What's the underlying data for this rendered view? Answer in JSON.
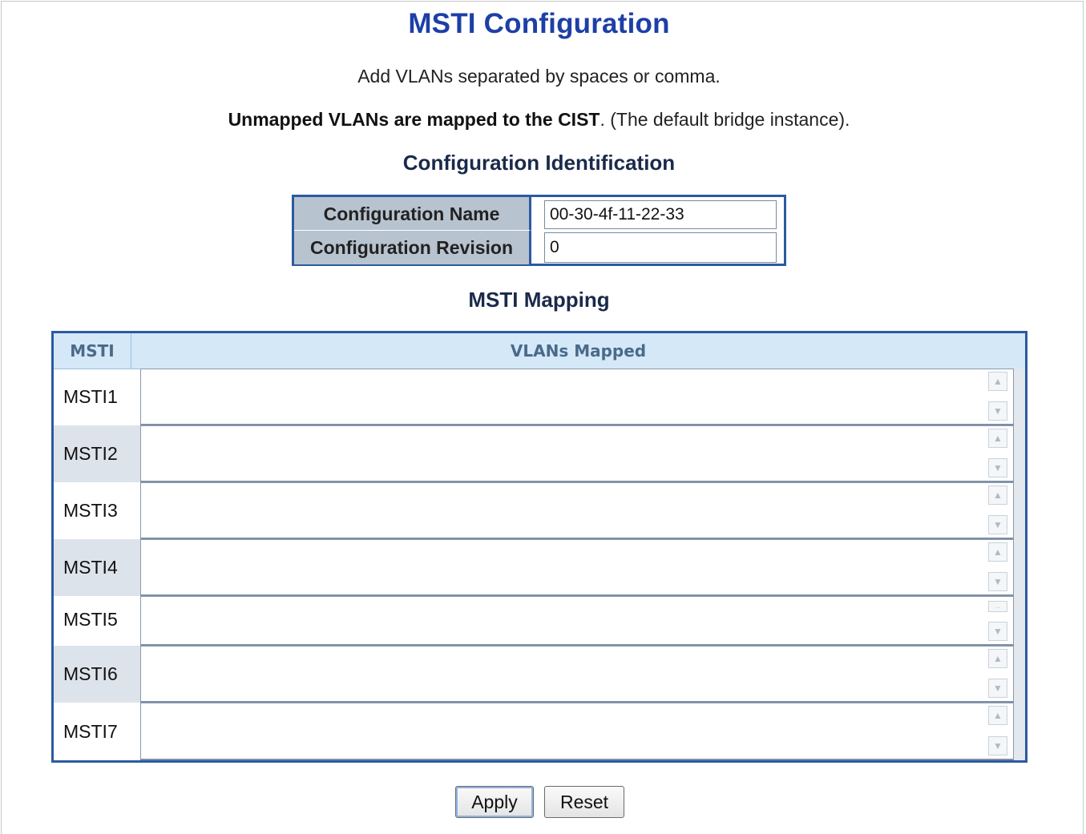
{
  "page": {
    "title": "MSTI Configuration",
    "instruction": "Add VLANs separated by spaces or comma.",
    "note_bold": "Unmapped VLANs are mapped to the CIST",
    "note_rest": ". (The default bridge instance)."
  },
  "config_identification": {
    "heading": "Configuration Identification",
    "name_label": "Configuration Name",
    "name_value": "00-30-4f-11-22-33",
    "revision_label": "Configuration Revision",
    "revision_value": "0"
  },
  "msti_mapping": {
    "heading": "MSTI Mapping",
    "columns": [
      "MSTI",
      "VLANs Mapped"
    ],
    "rows": [
      {
        "label": "MSTI1",
        "vlans": ""
      },
      {
        "label": "MSTI2",
        "vlans": ""
      },
      {
        "label": "MSTI3",
        "vlans": ""
      },
      {
        "label": "MSTI4",
        "vlans": ""
      },
      {
        "label": "MSTI5",
        "vlans": ""
      },
      {
        "label": "MSTI6",
        "vlans": ""
      },
      {
        "label": "MSTI7",
        "vlans": ""
      }
    ]
  },
  "buttons": {
    "apply": "Apply",
    "reset": "Reset"
  },
  "icons": {
    "scroll_up": "chevron-up-icon",
    "scroll_down": "chevron-down-icon"
  },
  "colors": {
    "title": "#1d3fa6",
    "table_border": "#2b5aa0",
    "header_bg": "#d4e8f8",
    "label_bg": "#b8c3d0"
  }
}
